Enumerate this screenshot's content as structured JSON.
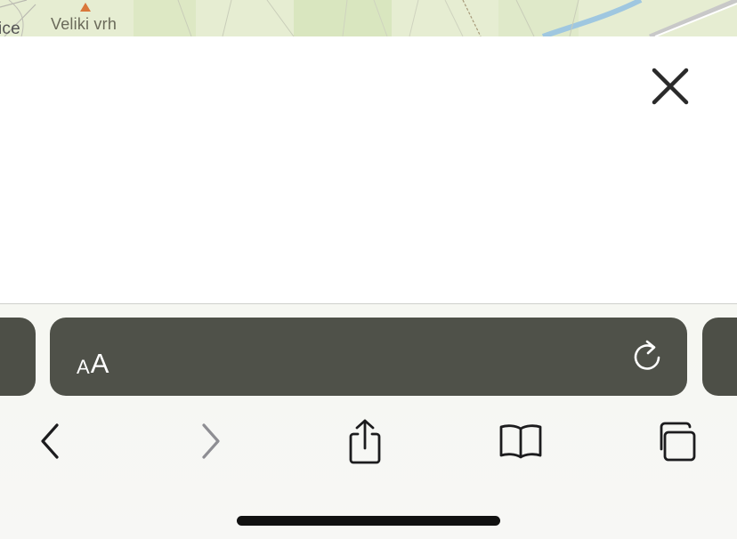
{
  "map": {
    "place_label": "Veliki vrh",
    "partial_label": "ice"
  },
  "sheet": {
    "close_label": "Close"
  },
  "address_bar": {
    "text_size_small": "A",
    "text_size_large": "A",
    "reload_label": "Reload"
  },
  "toolbar": {
    "back_label": "Back",
    "forward_label": "Forward",
    "share_label": "Share",
    "bookmarks_label": "Bookmarks",
    "tabs_label": "Tabs"
  },
  "colors": {
    "address_bar_bg": "#4f5149",
    "icon_dark": "#1c1c1e",
    "icon_disabled": "#8e8e93",
    "map_bg": "#e6edd2"
  }
}
